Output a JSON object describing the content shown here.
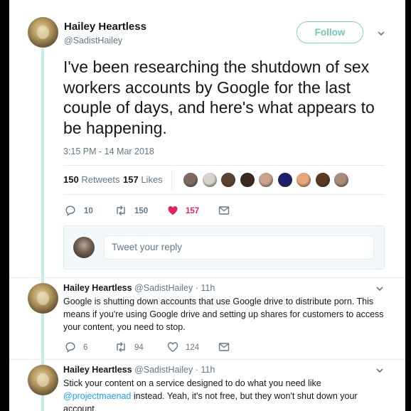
{
  "main_tweet": {
    "author_name": "Hailey Heartless",
    "author_handle": "@SadistHailey",
    "follow_label": "Follow",
    "text": "I've been researching the shutdown of sex workers accounts by Google for the last couple of days, and here's what appears to be happening.",
    "timestamp": "3:15 PM - 14 Mar 2018",
    "retweets_count": "150",
    "retweets_label": "Retweets",
    "likes_count": "157",
    "likes_label": "Likes",
    "actions": {
      "reply_count": "10",
      "retweet_count": "150",
      "like_count": "157"
    },
    "liker_avatar_colors": [
      "#7d6b60",
      "#d8d2cc",
      "#5a4330",
      "#3a2a20",
      "#c9a38c",
      "#1c1f6e",
      "#e8a67a",
      "#5a3a22",
      "#a88a78"
    ]
  },
  "reply_composer": {
    "placeholder": "Tweet your reply"
  },
  "colors": {
    "accent_teal": "#6fc8b5",
    "thread_line": "#c4ebe6",
    "like_red": "#e0245e",
    "link_blue": "#1da1f2",
    "muted": "#657786"
  },
  "replies": [
    {
      "author_name": "Hailey Heartless",
      "author_handle": "@SadistHailey",
      "time": "11h",
      "text": "Google is shutting down accounts that use Google drive to distribute porn. This means if you're using Google drive and setting up shares for customers to access your content, you need to stop.",
      "reply_count": "6",
      "retweet_count": "94",
      "like_count": "124"
    },
    {
      "author_name": "Hailey Heartless",
      "author_handle": "@SadistHailey",
      "time": "11h",
      "text_before": "Stick your content on a service designed to do what you need like ",
      "mention": "@projectmaenad",
      "text_after": " instead. Yeah, it's not free, but they won't shut down your account."
    }
  ]
}
